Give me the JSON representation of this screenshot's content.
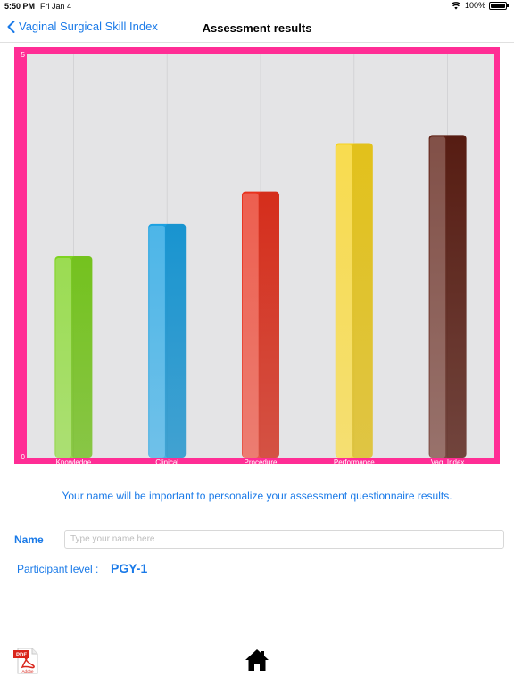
{
  "status_bar": {
    "time": "5:50 PM",
    "date": "Fri Jan 4",
    "battery": "100%",
    "icons": [
      "wifi-icon",
      "battery-icon"
    ]
  },
  "nav": {
    "back_label": "Vaginal Surgical Skill Index",
    "title": "Assessment results"
  },
  "chart_frame_color": "#ff2d95",
  "chart_data": {
    "type": "bar",
    "categories": [
      "Knowledge",
      "Clinical",
      "Procedure",
      "Performance",
      "Vag. Index"
    ],
    "values": [
      2.5,
      2.9,
      3.3,
      3.9,
      4.0
    ],
    "colors": [
      "#7ed321",
      "#1ba1e2",
      "#e8321e",
      "#f6d21e",
      "#5e1f14"
    ],
    "ylim": [
      0,
      5
    ],
    "y_tick_labels": [
      "0",
      "5"
    ],
    "title": "",
    "xlabel": "",
    "ylabel": "",
    "grid": true
  },
  "info": {
    "text": "Your name will be important to personalize your assessment questionnaire results."
  },
  "form": {
    "name_label": "Name",
    "name_placeholder": "Type your name here",
    "name_value": "",
    "level_label": "Participant level :",
    "level_value": "PGY-1"
  },
  "toolbar": {
    "icons": [
      "pdf-icon",
      "home-icon"
    ],
    "pdf_icon_text": "PDF",
    "pdf_brand_text": "Adobe"
  }
}
